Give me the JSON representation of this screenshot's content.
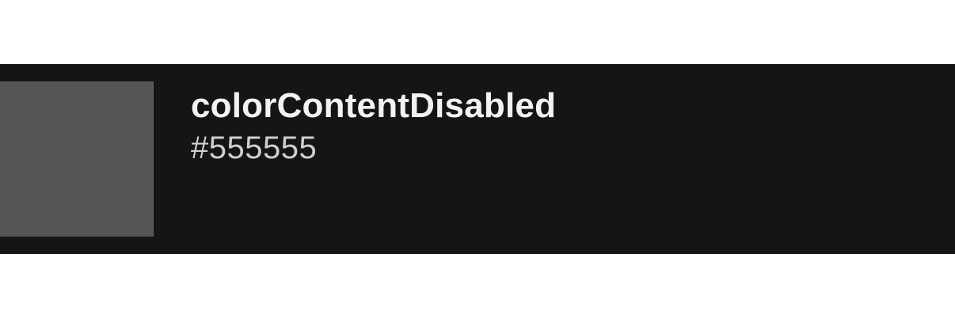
{
  "token": {
    "name": "colorContentDisabled",
    "value": "#555555",
    "swatch_color": "#555555"
  },
  "colors": {
    "page_background": "#ffffff",
    "card_background": "#151515",
    "name_text": "#f2f2f2",
    "value_text": "#cfcfcf"
  }
}
